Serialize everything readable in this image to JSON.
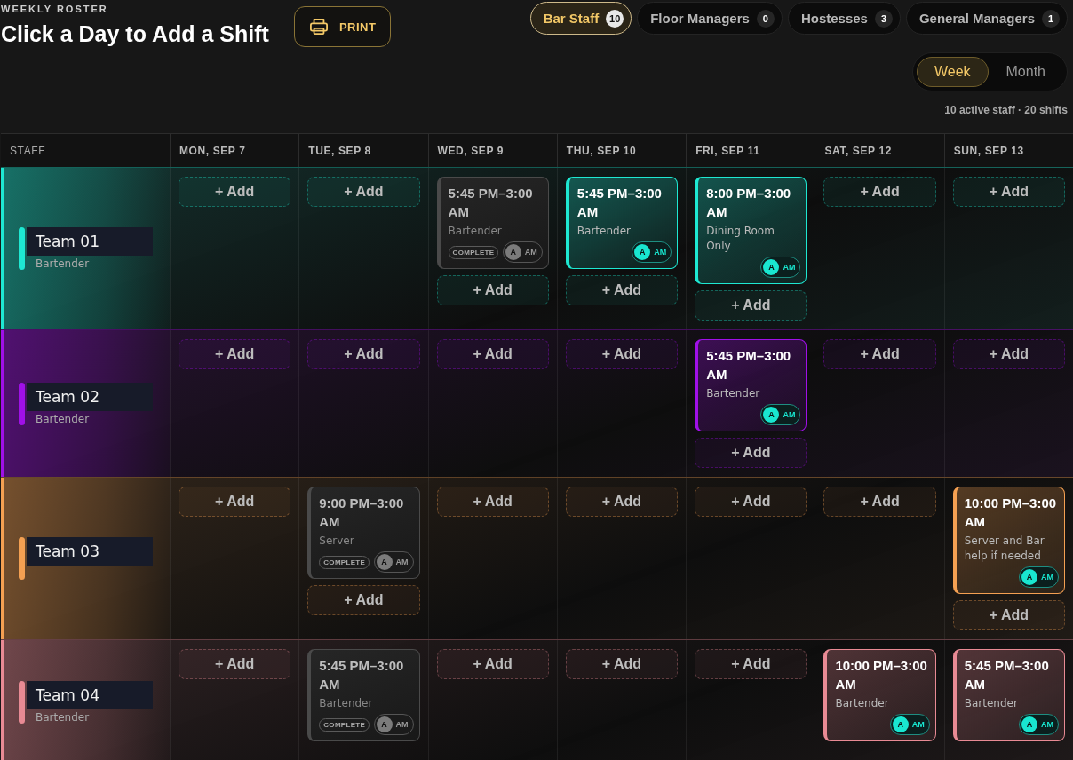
{
  "header": {
    "eyebrow": "WEEKLY ROSTER",
    "title": "Click a Day to Add a Shift",
    "print_button": "PRINT"
  },
  "tabs": [
    {
      "label": "Bar Staff",
      "count": "10",
      "selected": true
    },
    {
      "label": "Floor Managers",
      "count": "0",
      "selected": false
    },
    {
      "label": "Hostesses",
      "count": "3",
      "selected": false
    },
    {
      "label": "General Managers",
      "count": "1",
      "selected": false
    }
  ],
  "view_toggle": [
    {
      "label": "Week",
      "selected": true
    },
    {
      "label": "Month",
      "selected": false
    }
  ],
  "summary": "10 active staff · 20 shifts",
  "columns": [
    "STAFF",
    "MON, SEP 7",
    "TUE, SEP 8",
    "WED, SEP 9",
    "THU, SEP 10",
    "FRI, SEP 11",
    "SAT, SEP 12",
    "SUN, SEP 13"
  ],
  "teams": [
    {
      "name": "Team 01",
      "role": "Bartender",
      "color": "#1ee8d2",
      "days": [
        [
          {
            "kind": "add",
            "label": "+ Add"
          }
        ],
        [
          {
            "kind": "add",
            "label": "+ Add"
          }
        ],
        [
          {
            "kind": "shift",
            "time": "5:45 PM–3:00 AM",
            "note": "Bartender",
            "complete": true,
            "badge": "COMPLETE",
            "avatar": "A",
            "tag": "AM"
          },
          {
            "kind": "add",
            "label": "+ Add"
          }
        ],
        [
          {
            "kind": "shift",
            "time": "5:45 PM–3:00 AM",
            "note": "Bartender",
            "complete": false,
            "avatar": "A",
            "tag": "AM"
          },
          {
            "kind": "add",
            "label": "+ Add"
          }
        ],
        [
          {
            "kind": "shift",
            "time": "8:00 PM–3:00 AM",
            "note": "Dining Room Only",
            "complete": false,
            "avatar": "A",
            "tag": "AM"
          },
          {
            "kind": "add",
            "label": "+ Add"
          }
        ],
        [
          {
            "kind": "add",
            "label": "+ Add"
          }
        ],
        [
          {
            "kind": "add",
            "label": "+ Add"
          }
        ]
      ]
    },
    {
      "name": "Team 02",
      "role": "Bartender",
      "color": "#a010e8",
      "days": [
        [
          {
            "kind": "add",
            "label": "+ Add"
          }
        ],
        [
          {
            "kind": "add",
            "label": "+ Add"
          }
        ],
        [
          {
            "kind": "add",
            "label": "+ Add"
          }
        ],
        [
          {
            "kind": "add",
            "label": "+ Add"
          }
        ],
        [
          {
            "kind": "shift",
            "time": "5:45 PM–3:00 AM",
            "note": "Bartender",
            "complete": false,
            "avatar": "A",
            "tag": "AM"
          },
          {
            "kind": "add",
            "label": "+ Add"
          }
        ],
        [
          {
            "kind": "add",
            "label": "+ Add"
          }
        ],
        [
          {
            "kind": "add",
            "label": "+ Add"
          }
        ]
      ]
    },
    {
      "name": "Team 03",
      "color": "#f4a052",
      "days": [
        [
          {
            "kind": "add",
            "label": "+ Add"
          }
        ],
        [
          {
            "kind": "shift",
            "time": "9:00 PM–3:00 AM",
            "note": "Server",
            "complete": true,
            "badge": "COMPLETE",
            "avatar": "A",
            "tag": "AM"
          },
          {
            "kind": "add",
            "label": "+ Add"
          }
        ],
        [
          {
            "kind": "add",
            "label": "+ Add"
          }
        ],
        [
          {
            "kind": "add",
            "label": "+ Add"
          }
        ],
        [
          {
            "kind": "add",
            "label": "+ Add"
          }
        ],
        [
          {
            "kind": "add",
            "label": "+ Add"
          }
        ],
        [
          {
            "kind": "shift",
            "time": "10:00 PM–3:00 AM",
            "note": "Server and Bar help if needed",
            "complete": false,
            "avatar": "A",
            "tag": "AM"
          },
          {
            "kind": "add",
            "label": "+ Add"
          }
        ]
      ]
    },
    {
      "name": "Team 04",
      "role": "Bartender",
      "color": "#e88a94",
      "days": [
        [
          {
            "kind": "add",
            "label": "+ Add"
          }
        ],
        [
          {
            "kind": "shift",
            "time": "5:45 PM–3:00 AM",
            "note": "Bartender",
            "complete": true,
            "badge": "COMPLETE",
            "avatar": "A",
            "tag": "AM"
          }
        ],
        [
          {
            "kind": "add",
            "label": "+ Add"
          }
        ],
        [
          {
            "kind": "add",
            "label": "+ Add"
          }
        ],
        [
          {
            "kind": "add",
            "label": "+ Add"
          }
        ],
        [
          {
            "kind": "shift",
            "time": "10:00 PM–3:00 AM",
            "note": "Bartender",
            "complete": false,
            "avatar": "A",
            "tag": "AM"
          }
        ],
        [
          {
            "kind": "shift",
            "time": "5:45 PM–3:00 AM",
            "note": "Bartender",
            "complete": false,
            "avatar": "A",
            "tag": "AM"
          }
        ]
      ]
    }
  ]
}
